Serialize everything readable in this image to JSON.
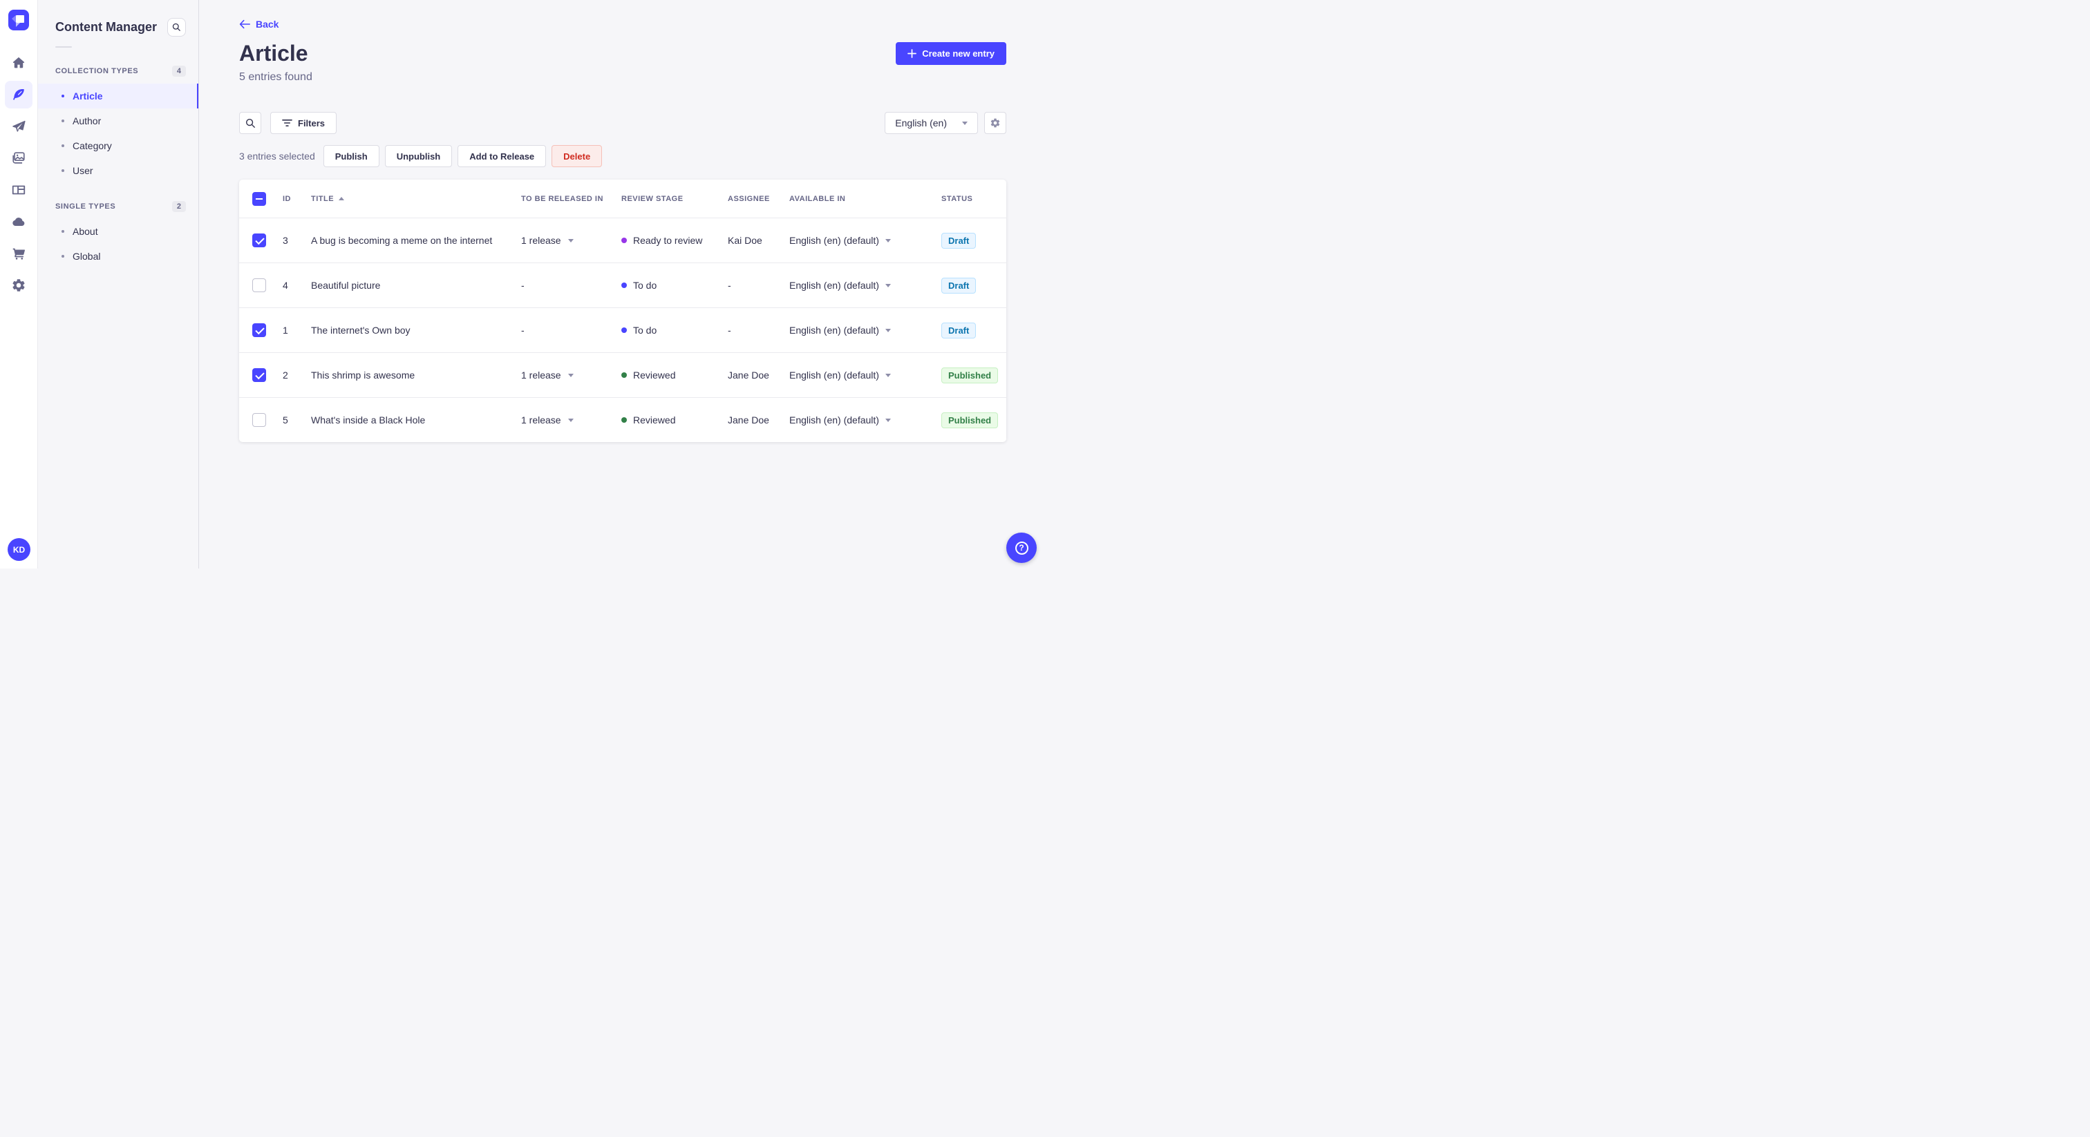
{
  "colors": {
    "primary": "#4945ff",
    "primary_light": "#f0f0ff",
    "page_background": "#f6f6f9",
    "danger_text": "#d02b20",
    "danger_background": "#fcecea",
    "draft_text": "#0c75af",
    "draft_background": "#eaf5ff",
    "published_text": "#328048",
    "published_background": "#eafbe7",
    "stage_ready_to_review": "#9736e8",
    "stage_to_do": "#4945ff",
    "stage_reviewed": "#328048"
  },
  "main_nav": {
    "logo_icon": "strapi-logo",
    "items": [
      {
        "icon": "home-icon",
        "active": false
      },
      {
        "icon": "feather-content-icon",
        "active": true
      },
      {
        "icon": "paper-plane-icon",
        "active": false
      },
      {
        "icon": "media-images-icon",
        "active": false
      },
      {
        "icon": "layout-icon",
        "active": false
      },
      {
        "icon": "cloud-icon",
        "active": false
      },
      {
        "icon": "shopping-cart-icon",
        "active": false
      },
      {
        "icon": "gear-icon",
        "active": false
      }
    ],
    "avatar_initials": "KD"
  },
  "subnav": {
    "title": "Content Manager",
    "search_icon": "search-icon",
    "sections": [
      {
        "label": "COLLECTION TYPES",
        "count": "4",
        "items": [
          {
            "label": "Article",
            "active": true
          },
          {
            "label": "Author",
            "active": false
          },
          {
            "label": "Category",
            "active": false
          },
          {
            "label": "User",
            "active": false
          }
        ]
      },
      {
        "label": "SINGLE TYPES",
        "count": "2",
        "items": [
          {
            "label": "About",
            "active": false
          },
          {
            "label": "Global",
            "active": false
          }
        ]
      }
    ]
  },
  "header": {
    "back_label": "Back",
    "title": "Article",
    "subtitle": "5 entries found",
    "create_button_label": "Create new entry"
  },
  "toolbar": {
    "search_icon": "search-icon",
    "filters_label": "Filters",
    "locale_value": "English (en)",
    "settings_icon": "gear-icon"
  },
  "selection": {
    "text": "3 entries selected",
    "publish_label": "Publish",
    "unpublish_label": "Unpublish",
    "add_to_release_label": "Add to Release",
    "delete_label": "Delete"
  },
  "table": {
    "columns": [
      "ID",
      "TITLE",
      "TO BE RELEASED IN",
      "REVIEW STAGE",
      "ASSIGNEE",
      "AVAILABLE IN",
      "STATUS"
    ],
    "sorted_column": "TITLE",
    "sort_direction": "asc",
    "header_checkbox_state": "indeterminate",
    "rows": [
      {
        "selected": true,
        "id": "3",
        "title": "A bug is becoming a meme on the internet",
        "release": "1 release",
        "stage": "Ready to review",
        "assignee": "Kai Doe",
        "locale": "English (en) (default)",
        "status": "Draft"
      },
      {
        "selected": false,
        "id": "4",
        "title": "Beautiful picture",
        "release": "-",
        "stage": "To do",
        "assignee": "-",
        "locale": "English (en) (default)",
        "status": "Draft"
      },
      {
        "selected": true,
        "id": "1",
        "title": "The internet's Own boy",
        "release": "-",
        "stage": "To do",
        "assignee": "-",
        "locale": "English (en) (default)",
        "status": "Draft"
      },
      {
        "selected": true,
        "id": "2",
        "title": "This shrimp is awesome",
        "release": "1 release",
        "stage": "Reviewed",
        "assignee": "Jane Doe",
        "locale": "English (en) (default)",
        "status": "Published"
      },
      {
        "selected": false,
        "id": "5",
        "title": "What's inside a Black Hole",
        "release": "1 release",
        "stage": "Reviewed",
        "assignee": "Jane Doe",
        "locale": "English (en) (default)",
        "status": "Published"
      }
    ]
  },
  "help": {
    "icon": "question-mark-icon"
  }
}
